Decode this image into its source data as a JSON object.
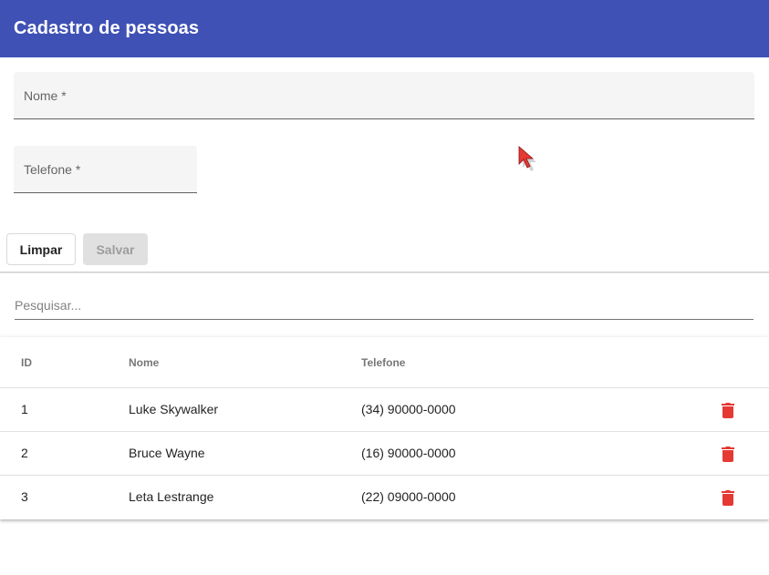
{
  "app": {
    "title": "Cadastro de pessoas",
    "toolbar_color": "#3f51b5"
  },
  "form": {
    "nome_label": "Nome *",
    "telefone_label": "Telefone *",
    "clear_button": "Limpar",
    "save_button": "Salvar"
  },
  "search": {
    "placeholder": "Pesquisar..."
  },
  "table": {
    "headers": {
      "id": "ID",
      "nome": "Nome",
      "telefone": "Telefone"
    },
    "rows": [
      {
        "id": "1",
        "nome": "Luke Skywalker",
        "telefone": "(34) 90000-0000"
      },
      {
        "id": "2",
        "nome": "Bruce Wayne",
        "telefone": "(16) 90000-0000"
      },
      {
        "id": "3",
        "nome": "Leta Lestrange",
        "telefone": "(22) 09000-0000"
      }
    ],
    "delete_icon": "trash-icon",
    "delete_color": "#e53935"
  }
}
